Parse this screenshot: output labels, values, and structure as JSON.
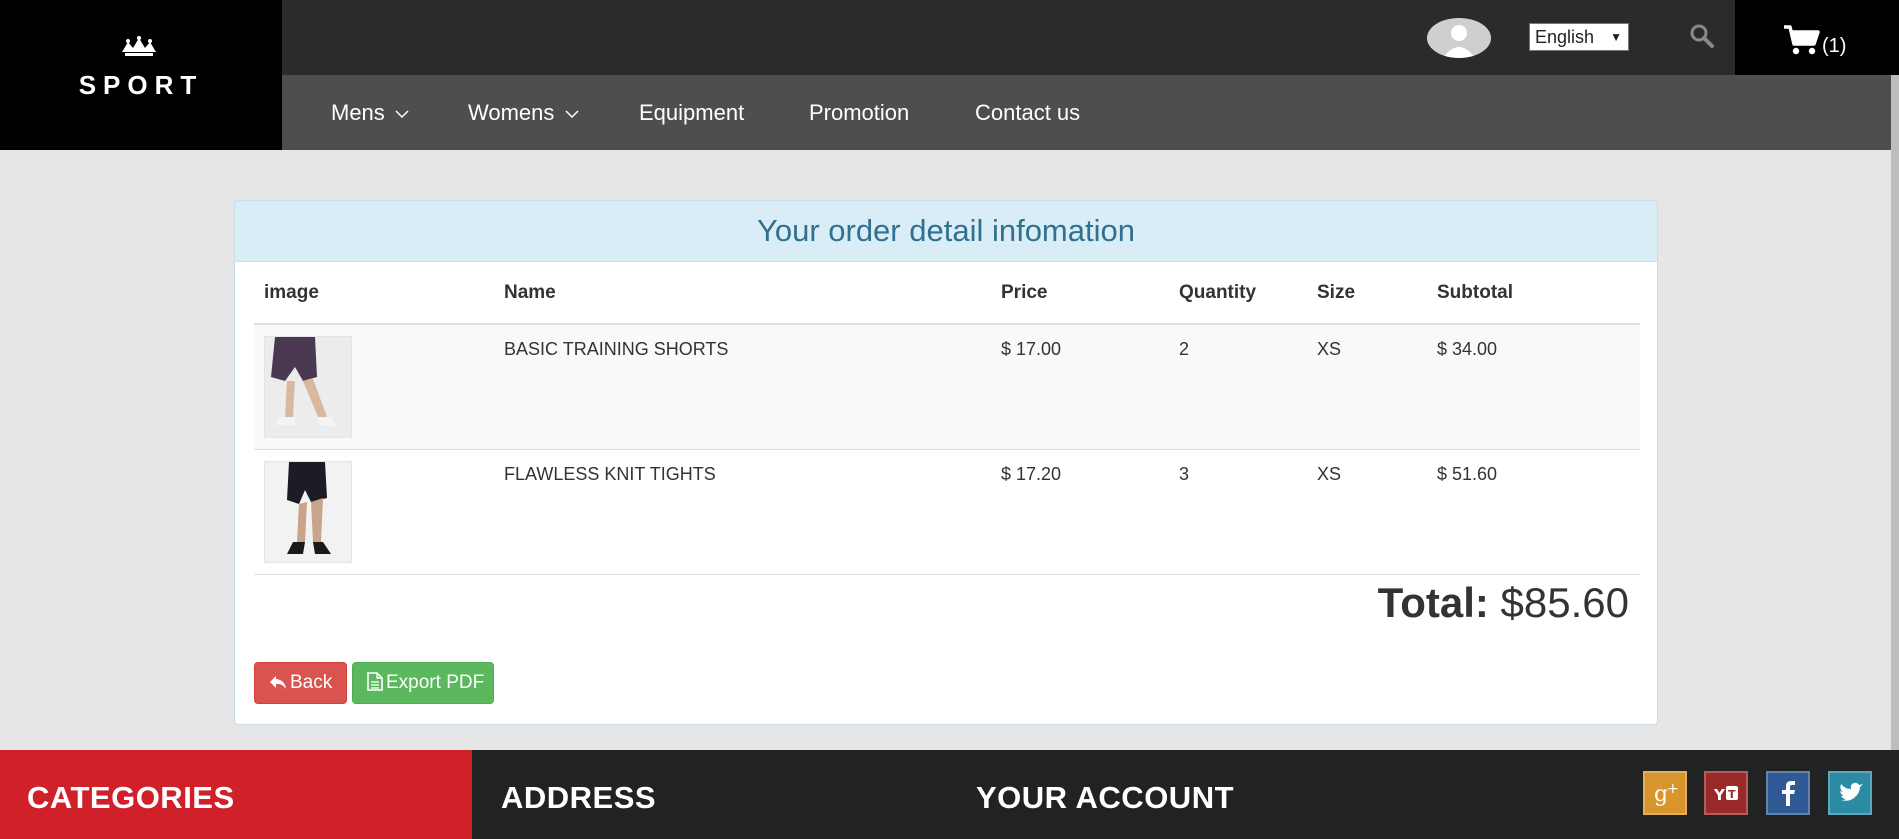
{
  "brand": {
    "name": "SPORT"
  },
  "header": {
    "language": "English",
    "cart_count": "(1)"
  },
  "nav": {
    "items": [
      "Mens",
      "Womens",
      "Equipment",
      "Promotion",
      "Contact us"
    ]
  },
  "order": {
    "heading": "Your order detail infomation",
    "columns": [
      "image",
      "Name",
      "Price",
      "Quantity",
      "Size",
      "Subtotal"
    ],
    "rows": [
      {
        "name": "BASIC TRAINING SHORTS",
        "price": "$ 17.00",
        "quantity": "2",
        "size": "XS",
        "subtotal": "$ 34.00"
      },
      {
        "name": "FLAWLESS KNIT TIGHTS",
        "price": "$ 17.20",
        "quantity": "3",
        "size": "XS",
        "subtotal": "$ 51.60"
      }
    ],
    "total_label": "Total:",
    "total_value": "$85.60",
    "back_label": "Back",
    "export_label": "Export PDF"
  },
  "footer": {
    "categories": "CATEGORIES",
    "address": "ADDRESS",
    "account": "YOUR ACCOUNT"
  },
  "colors": {
    "google": "#d8952c",
    "youtube": "#9a2a2a",
    "facebook": "#2f5a95",
    "twitter": "#2b8aa4"
  }
}
